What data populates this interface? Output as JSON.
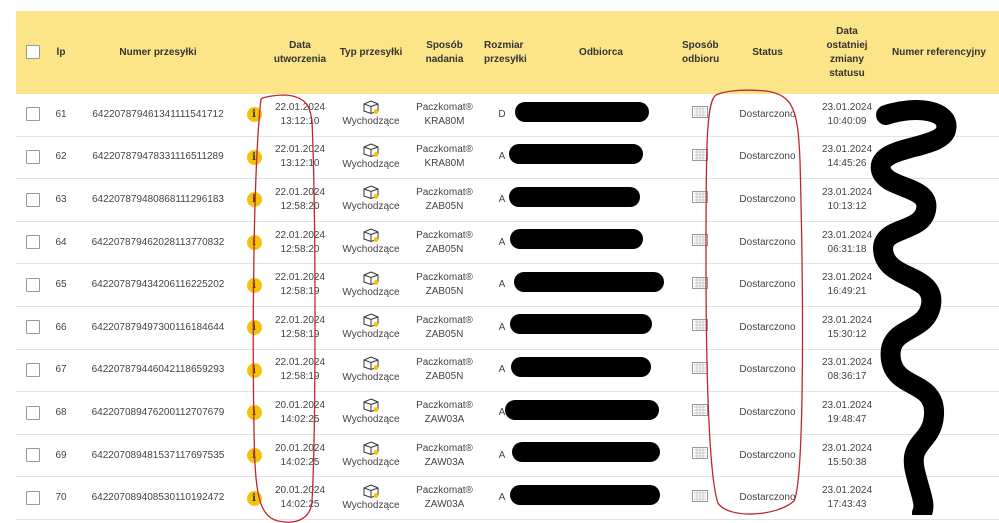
{
  "table": {
    "headers": {
      "lp": "lp",
      "number": "Numer przesyłki",
      "created": "Data utworzenia",
      "type": "Typ przesyłki",
      "send_method": "Sposób nadania",
      "size": "Rozmiar przesyłki",
      "recipient": "Odbiorca",
      "pickup": "Sposób odbioru",
      "status": "Status",
      "last_change": "Data ostatniej zmiany statusu",
      "reference": "Numer referencyjny"
    },
    "rows": [
      {
        "lp": "61",
        "number": "642207879461341111541712",
        "created_date": "22.01.2024",
        "created_time": "13:12:10",
        "type": "Wychodzące",
        "method_name": "Paczkomat®",
        "method_code": "KRA80M",
        "size": "D",
        "status": "Dostarczono",
        "changed_date": "23.01.2024",
        "changed_time": "10:40:09"
      },
      {
        "lp": "62",
        "number": "642207879478331116511289",
        "created_date": "22.01.2024",
        "created_time": "13:12:10",
        "type": "Wychodzące",
        "method_name": "Paczkomat®",
        "method_code": "KRA80M",
        "size": "A",
        "status": "Dostarczono",
        "changed_date": "23.01.2024",
        "changed_time": "14:45:26"
      },
      {
        "lp": "63",
        "number": "642207879480868111296183",
        "created_date": "22.01.2024",
        "created_time": "12:58:20",
        "type": "Wychodzące",
        "method_name": "Paczkomat®",
        "method_code": "ZAB05N",
        "size": "A",
        "status": "Dostarczono",
        "changed_date": "23.01.2024",
        "changed_time": "10:13:12"
      },
      {
        "lp": "64",
        "number": "642207879462028113770832",
        "created_date": "22.01.2024",
        "created_time": "12:58:20",
        "type": "Wychodzące",
        "method_name": "Paczkomat®",
        "method_code": "ZAB05N",
        "size": "A",
        "status": "Dostarczono",
        "changed_date": "23.01.2024",
        "changed_time": "06:31:18"
      },
      {
        "lp": "65",
        "number": "642207879434206116225202",
        "created_date": "22.01.2024",
        "created_time": "12:58:19",
        "type": "Wychodzące",
        "method_name": "Paczkomat®",
        "method_code": "ZAB05N",
        "size": "A",
        "status": "Dostarczono",
        "changed_date": "23.01.2024",
        "changed_time": "16:49:21"
      },
      {
        "lp": "66",
        "number": "642207879497300116184644",
        "created_date": "22.01.2024",
        "created_time": "12:58:19",
        "type": "Wychodzące",
        "method_name": "Paczkomat®",
        "method_code": "ZAB05N",
        "size": "A",
        "status": "Dostarczono",
        "changed_date": "23.01.2024",
        "changed_time": "15:30:12"
      },
      {
        "lp": "67",
        "number": "642207879446042118659293",
        "created_date": "22.01.2024",
        "created_time": "12:58:19",
        "type": "Wychodzące",
        "method_name": "Paczkomat®",
        "method_code": "ZAB05N",
        "size": "A",
        "status": "Dostarczono",
        "changed_date": "23.01.2024",
        "changed_time": "08:36:17"
      },
      {
        "lp": "68",
        "number": "642207089476200112707679",
        "created_date": "20.01.2024",
        "created_time": "14:02:25",
        "type": "Wychodzące",
        "method_name": "Paczkomat®",
        "method_code": "ZAW03A",
        "size": "A",
        "status": "Dostarczono",
        "changed_date": "23.01.2024",
        "changed_time": "19:48:47"
      },
      {
        "lp": "69",
        "number": "642207089481537117697535",
        "created_date": "20.01.2024",
        "created_time": "14:02:25",
        "type": "Wychodzące",
        "method_name": "Paczkomat®",
        "method_code": "ZAW03A",
        "size": "A",
        "status": "Dostarczono",
        "changed_date": "23.01.2024",
        "changed_time": "15:50:38"
      },
      {
        "lp": "70",
        "number": "642207089408530110192472",
        "created_date": "20.01.2024",
        "created_time": "14:02:25",
        "type": "Wychodzące",
        "method_name": "Paczkomat®",
        "method_code": "ZAW03A",
        "size": "A",
        "status": "Dostarczono",
        "changed_date": "23.01.2024",
        "changed_time": "17:43:43"
      }
    ]
  },
  "icons": {
    "info": "info-icon",
    "package": "package-icon",
    "pickup": "parcel-locker-icon"
  },
  "colors": {
    "header_bg": "#fce588",
    "info_icon": "#f4c20d",
    "annotation": "#c0272d"
  }
}
